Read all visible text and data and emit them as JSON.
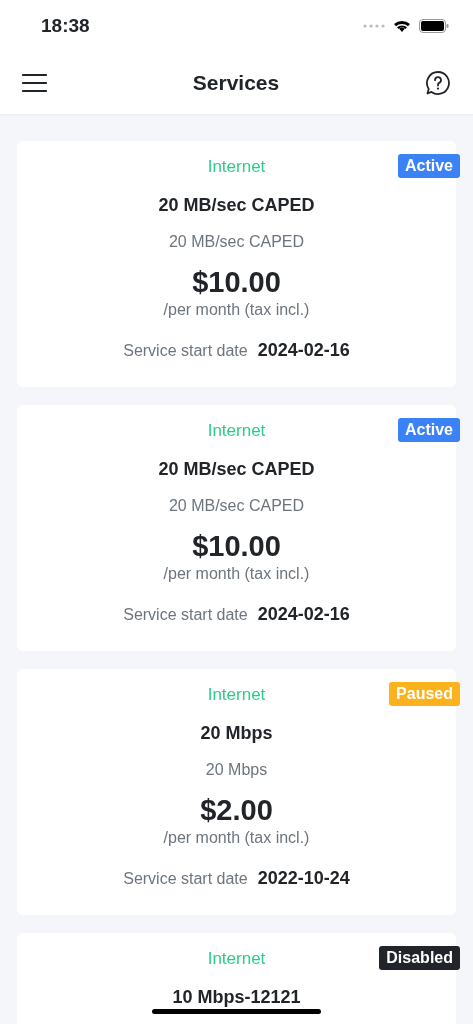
{
  "status_bar": {
    "time": "18:38"
  },
  "header": {
    "title": "Services"
  },
  "services": [
    {
      "category": "Internet",
      "status": "Active",
      "color": "#3b82f6",
      "name": "20 MB/sec CAPED",
      "description": "20 MB/sec CAPED",
      "price": "$10.00",
      "period": "/per month (tax incl.)",
      "start_label": "Service start date",
      "start_date": "2024-02-16"
    },
    {
      "category": "Internet",
      "status": "Active",
      "color": "#3b82f6",
      "name": "20 MB/sec CAPED",
      "description": "20 MB/sec CAPED",
      "price": "$10.00",
      "period": "/per month (tax incl.)",
      "start_label": "Service start date",
      "start_date": "2024-02-16"
    },
    {
      "category": "Internet",
      "status": "Paused",
      "color": "#fbb21d",
      "name": "20 Mbps",
      "description": "20 Mbps",
      "price": "$2.00",
      "period": "/per month (tax incl.)",
      "start_label": "Service start date",
      "start_date": "2022-10-24"
    },
    {
      "category": "Internet",
      "status": "Disabled",
      "color": "#212529",
      "name": "10 Mbps-12121"
    }
  ]
}
